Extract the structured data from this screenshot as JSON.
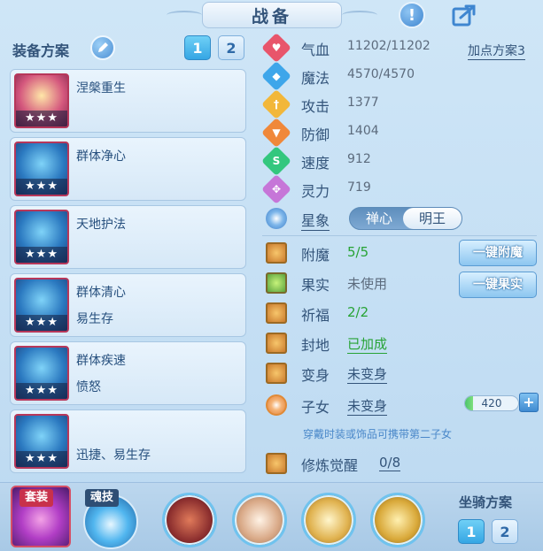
{
  "header": {
    "title": "战备"
  },
  "equipment": {
    "title": "装备方案",
    "plan_tabs": [
      "1",
      "2"
    ],
    "cards": [
      {
        "line1": "涅槃重生",
        "line2": "",
        "stars": "★★★"
      },
      {
        "line1": "群体净心",
        "line2": "",
        "stars": "★★★"
      },
      {
        "line1": "天地护法",
        "line2": "",
        "stars": "★★★"
      },
      {
        "line1": "群体清心",
        "line2": "易生存",
        "stars": "★★★"
      },
      {
        "line1": "群体疾速",
        "line2": "愤怒",
        "stars": "★★★"
      },
      {
        "line1": "",
        "line2": "迅捷、易生存",
        "stars": "★★★"
      }
    ]
  },
  "stats": {
    "plan_link": "加点方案3",
    "rows": [
      {
        "label": "气血",
        "value": "11202/11202",
        "color": "#e8556b",
        "icon": "heart-icon"
      },
      {
        "label": "魔法",
        "value": "4570/4570",
        "color": "#3ea6ea",
        "icon": "mana-icon"
      },
      {
        "label": "攻击",
        "value": "1377",
        "color": "#f2b73a",
        "icon": "sword-icon"
      },
      {
        "label": "防御",
        "value": "1404",
        "color": "#f0883a",
        "icon": "shield-icon"
      },
      {
        "label": "速度",
        "value": "912",
        "color": "#33c77e",
        "icon": "speed-icon"
      },
      {
        "label": "灵力",
        "value": "719",
        "color": "#c676d8",
        "icon": "spirit-icon"
      }
    ]
  },
  "constellation": {
    "label": "星象",
    "options": [
      "禅心",
      "明王"
    ],
    "selected": "明王"
  },
  "features": {
    "rows": [
      {
        "label": "附魔",
        "value": "5/5",
        "style": "green",
        "icon": "enchant-icon"
      },
      {
        "label": "果实",
        "value": "未使用",
        "style": "gray",
        "icon": "fruit-icon"
      },
      {
        "label": "祈福",
        "value": "2/2",
        "style": "green",
        "icon": "bless-icon"
      },
      {
        "label": "封地",
        "value": "已加成",
        "style": "green-link",
        "icon": "fief-icon"
      },
      {
        "label": "变身",
        "value": "未变身",
        "style": "link",
        "icon": "transform-icon"
      },
      {
        "label": "子女",
        "value": "未变身",
        "style": "link",
        "icon": "child-icon"
      }
    ],
    "buttons": {
      "enchant": "一键附魔",
      "fruit": "一键果实"
    },
    "pet_value": "420",
    "pet_fill_percent": 15,
    "plus": "+",
    "hint": "穿戴时装或饰品可携带第二子女",
    "awaken": {
      "label": "修炼觉醒",
      "value": "0/8"
    }
  },
  "bottom": {
    "suit_tag": "套装",
    "soul_tag": "魂技",
    "mount_title": "坐骑方案",
    "mount_tabs": [
      "1",
      "2"
    ]
  },
  "colors": {
    "accent": "#35a6e4",
    "green": "#27a335",
    "text": "#33547a"
  }
}
